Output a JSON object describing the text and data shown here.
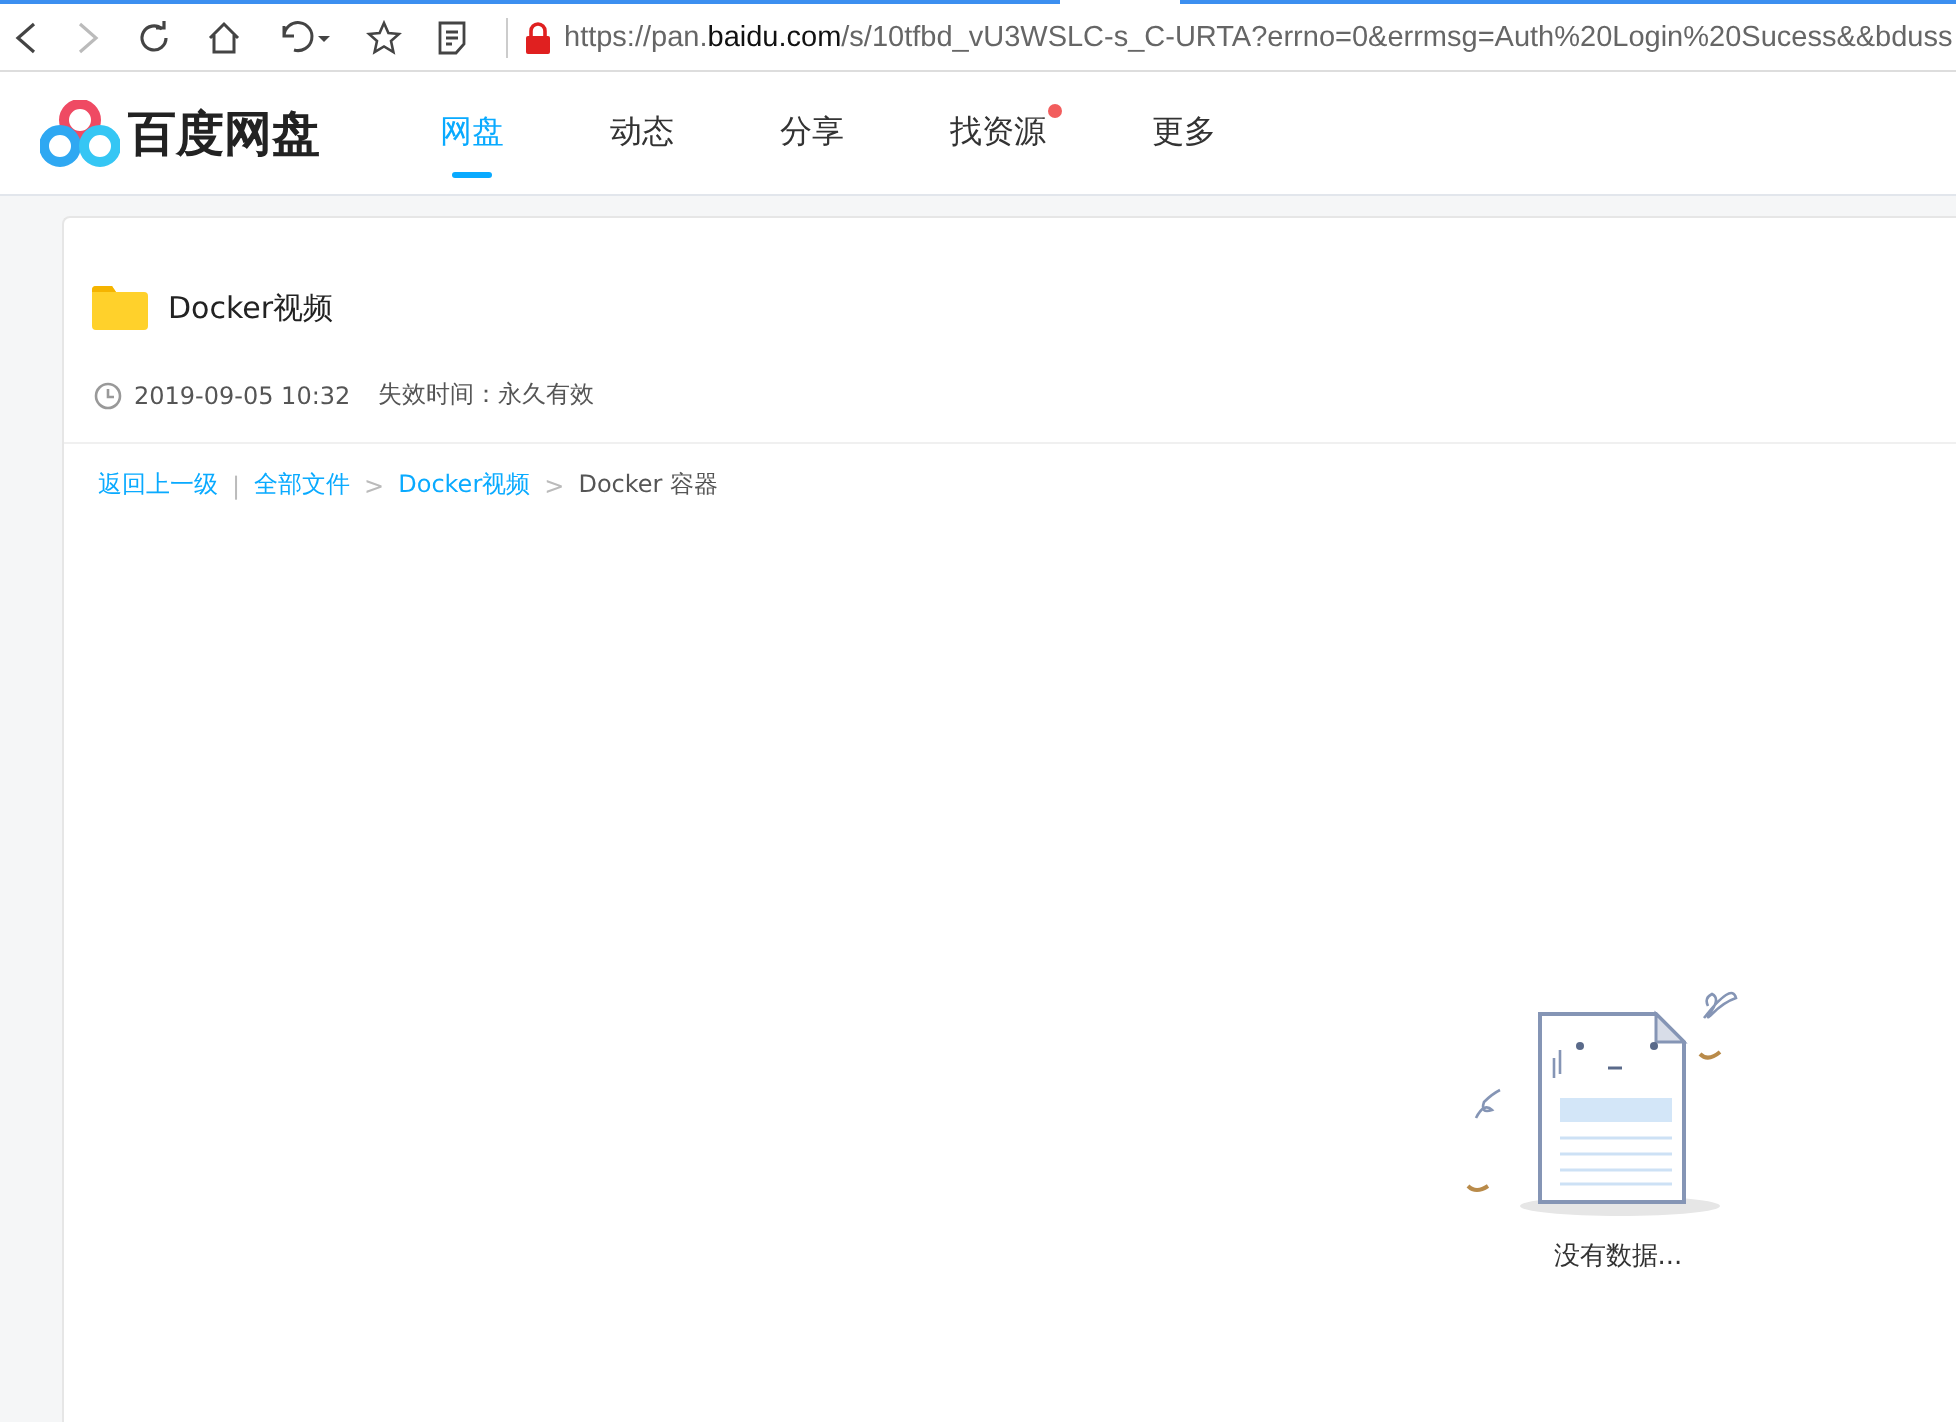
{
  "browser": {
    "url": {
      "prefix": "https://pan.",
      "domain": "baidu.com",
      "path": "/s/10tfbd_vU3WSLC-s_C-URTA?errno=0&errmsg=Auth%20Login%20Sucess&&bduss"
    },
    "forward_disabled": true
  },
  "header": {
    "logo_text": "百度网盘",
    "tabs": [
      {
        "label": "网盘",
        "selected": true,
        "badge": false
      },
      {
        "label": "动态",
        "selected": false,
        "badge": false
      },
      {
        "label": "分享",
        "selected": false,
        "badge": false
      },
      {
        "label": "找资源",
        "selected": false,
        "badge": true
      },
      {
        "label": "更多",
        "selected": false,
        "badge": false
      }
    ]
  },
  "share": {
    "title": "Docker视频",
    "date": "2019-09-05 10:32",
    "expiry": "失效时间：永久有效",
    "breadcrumb": [
      {
        "text": "返回上一级",
        "kind": "link"
      },
      {
        "text": "|",
        "kind": "separator"
      },
      {
        "text": "全部文件",
        "kind": "link"
      },
      {
        "text": ">",
        "kind": "separator"
      },
      {
        "text": "Docker视频",
        "kind": "link"
      },
      {
        "text": ">",
        "kind": "separator"
      },
      {
        "text": "Docker 容器",
        "kind": "current"
      }
    ],
    "empty_text": "没有数据..."
  }
}
